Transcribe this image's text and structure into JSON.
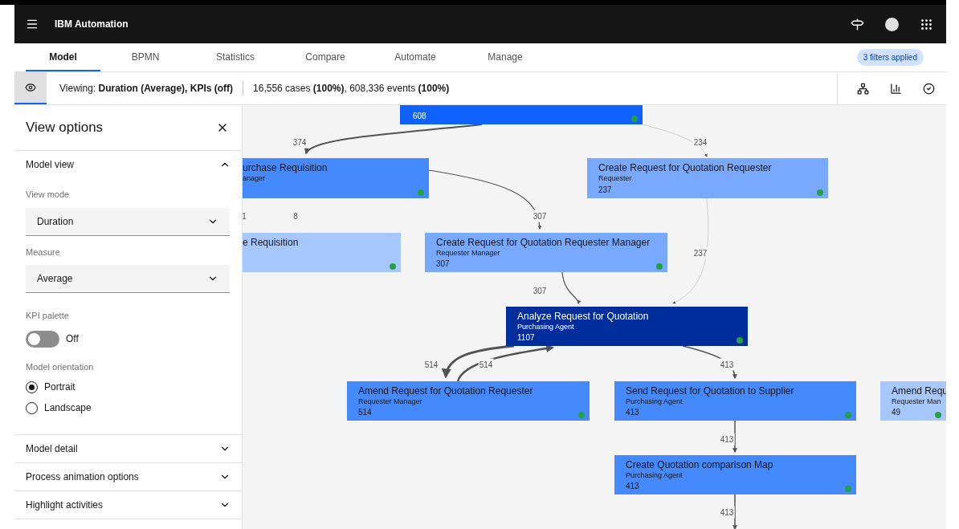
{
  "header": {
    "product": "IBM Automation"
  },
  "tabs": [
    {
      "label": "Model",
      "selected": true
    },
    {
      "label": "BPMN",
      "selected": false
    },
    {
      "label": "Statistics",
      "selected": false
    },
    {
      "label": "Compare",
      "selected": false
    },
    {
      "label": "Automate",
      "selected": false
    },
    {
      "label": "Manage",
      "selected": false
    }
  ],
  "filter_badge": "3 filters applied",
  "viewing_bar": {
    "viewing": "Viewing: **Duration (Average), KPIs (off)**",
    "totals": "16,556 cases **(100%)**, 608,336 events **(100%)**"
  },
  "view_options": {
    "title": "View options",
    "model_view": {
      "title": "Model view",
      "expanded": true,
      "view_mode": {
        "label": "View mode",
        "value": "Duration"
      },
      "measure": {
        "label": "Measure",
        "value": "Average"
      },
      "kpi_palette": {
        "label": "KPI palette",
        "on": false,
        "state_text": "Off"
      },
      "orientation": {
        "label": "Model orientation",
        "options": [
          {
            "label": "Portrait",
            "selected": true
          },
          {
            "label": "Landscape",
            "selected": false
          }
        ]
      }
    },
    "sections": [
      {
        "title": "Model detail",
        "expanded": false
      },
      {
        "title": "Process animation options",
        "expanded": false
      },
      {
        "title": "Highlight activities",
        "expanded": false
      }
    ]
  },
  "diagram": {
    "nodes": [
      {
        "count": "608",
        "color": "#0f62fe"
      },
      {
        "title": "urchase Requisition",
        "role": "anager",
        "color": "#4589ff"
      },
      {
        "title": "Create Request for Quotation Requester",
        "role": "Requester",
        "count": "237",
        "color": "#78a9ff"
      },
      {
        "title": "e Requisition",
        "color": "#a6c8ff"
      },
      {
        "title": "Create Request for Quotation Requester Manager",
        "role": "Requester Manager",
        "count": "307",
        "color": "#78a9ff"
      },
      {
        "title": "Analyze Request for Quotation",
        "role": "Purchasing Agent",
        "count": "1107",
        "color": "#002d9c"
      },
      {
        "title": "Amend Request for Quotation Requester",
        "role": "Requester Manager",
        "count": "514",
        "color": "#4589ff"
      },
      {
        "title": "Send Request for Quotation to Supplier",
        "role": "Purchasing Agent",
        "count": "413",
        "color": "#4589ff"
      },
      {
        "title": "Amend Requ",
        "role": "Requester Man",
        "count": "49",
        "color": "#a6c8ff"
      },
      {
        "title": "Create Quotation comparison Map",
        "role": "Purchasing Agent",
        "count": "413",
        "color": "#4589ff"
      }
    ],
    "edge_labels": [
      "374",
      "234",
      "1",
      "8",
      "307",
      "237",
      "307",
      "514",
      "514",
      "413",
      "413",
      "413"
    ]
  }
}
